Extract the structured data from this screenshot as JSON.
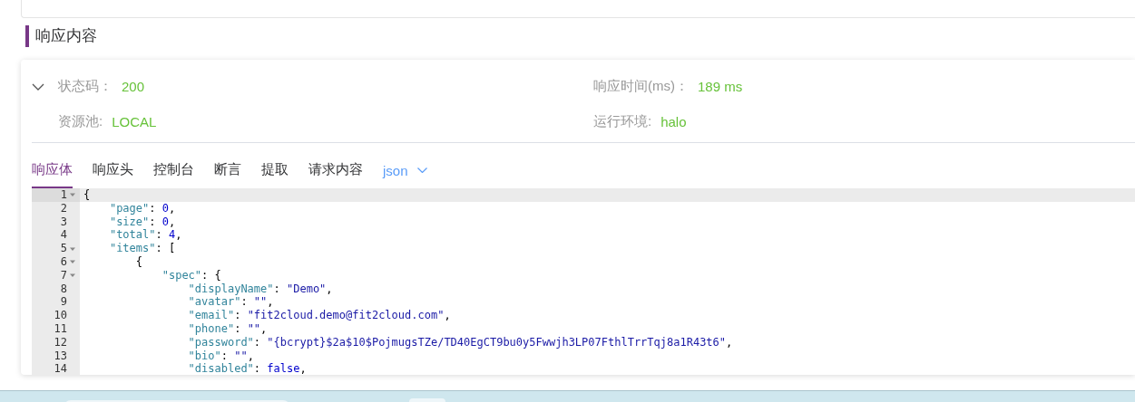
{
  "section_title": "响应内容",
  "summary": {
    "expanded": true,
    "fields": [
      {
        "label": "状态码：",
        "value": "200"
      },
      {
        "label": "响应时间(ms)：",
        "value": "189 ms"
      },
      {
        "label": "资源池:",
        "value": "LOCAL"
      },
      {
        "label": "运行环境:",
        "value": "halo"
      }
    ]
  },
  "tabs": [
    {
      "label": "响应体",
      "selected": true
    },
    {
      "label": "响应头",
      "selected": false
    },
    {
      "label": "控制台",
      "selected": false
    },
    {
      "label": "断言",
      "selected": false
    },
    {
      "label": "提取",
      "selected": false
    },
    {
      "label": "请求内容",
      "selected": false
    }
  ],
  "format_select": {
    "value": "json"
  },
  "editor": {
    "lines": [
      {
        "number": "1",
        "code": "{",
        "foldable": true,
        "active": true
      },
      {
        "number": "2",
        "code": "    \"page\": 0,",
        "foldable": false,
        "active": false
      },
      {
        "number": "3",
        "code": "    \"size\": 0,",
        "foldable": false,
        "active": false
      },
      {
        "number": "4",
        "code": "    \"total\": 4,",
        "foldable": false,
        "active": false
      },
      {
        "number": "5",
        "code": "    \"items\": [",
        "foldable": true,
        "active": false
      },
      {
        "number": "6",
        "code": "        {",
        "foldable": true,
        "active": false
      },
      {
        "number": "7",
        "code": "            \"spec\": {",
        "foldable": true,
        "active": false
      },
      {
        "number": "8",
        "code": "                \"displayName\": \"Demo\",",
        "foldable": false,
        "active": false
      },
      {
        "number": "9",
        "code": "                \"avatar\": \"\",",
        "foldable": false,
        "active": false
      },
      {
        "number": "10",
        "code": "                \"email\": \"fit2cloud.demo@fit2cloud.com\",",
        "foldable": false,
        "active": false
      },
      {
        "number": "11",
        "code": "                \"phone\": \"\",",
        "foldable": false,
        "active": false
      },
      {
        "number": "12",
        "code": "                \"password\": \"{bcrypt}$2a$10$PojmugsTZe/TD40EgCT9bu0y5Fwwjh3LP07FthlTrrTqj8a1R43t6\",",
        "foldable": false,
        "active": false
      },
      {
        "number": "13",
        "code": "                \"bio\": \"\",",
        "foldable": false,
        "active": false
      },
      {
        "number": "14",
        "code": "                \"disabled\": false,",
        "foldable": false,
        "active": false
      }
    ]
  }
}
